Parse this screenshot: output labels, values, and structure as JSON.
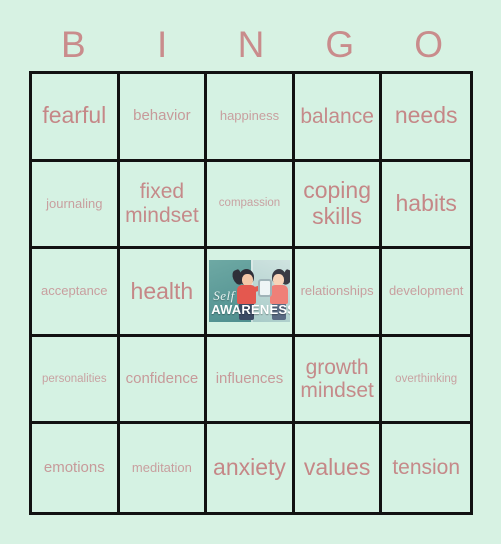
{
  "card": {
    "title": "BINGO",
    "header_letters": [
      "B",
      "I",
      "N",
      "G",
      "O"
    ],
    "background_color": "#d7f2e3",
    "cell_color": "#d5f2e3",
    "border_color": "#121212",
    "text_color": "#c89393",
    "header_color": "#c98c8c"
  },
  "free_space": {
    "row": 3,
    "column": 3,
    "image_name": "self-awareness-illustration",
    "script_text": "Self",
    "bold_text": "AWARENESS",
    "description": "girl holding a hand mirror with her reflection"
  },
  "rows": [
    [
      {
        "label": "fearful",
        "size": "xl"
      },
      {
        "label": "behavior",
        "size": "md"
      },
      {
        "label": "happiness",
        "size": "sm"
      },
      {
        "label": "balance",
        "size": "lg"
      },
      {
        "label": "needs",
        "size": "xl"
      }
    ],
    [
      {
        "label": "journaling",
        "size": "sm"
      },
      {
        "label": "fixed mindset",
        "size": "lg"
      },
      {
        "label": "compassion",
        "size": "xs"
      },
      {
        "label": "coping skills",
        "size": "xl"
      },
      {
        "label": "habits",
        "size": "xl"
      }
    ],
    [
      {
        "label": "acceptance",
        "size": "sm"
      },
      {
        "label": "health",
        "size": "xl"
      },
      {
        "label": "",
        "size": "free"
      },
      {
        "label": "relationships",
        "size": "sm"
      },
      {
        "label": "development",
        "size": "sm"
      }
    ],
    [
      {
        "label": "personalities",
        "size": "xs"
      },
      {
        "label": "confidence",
        "size": "md"
      },
      {
        "label": "influences",
        "size": "md"
      },
      {
        "label": "growth mindset",
        "size": "lg"
      },
      {
        "label": "overthinking",
        "size": "xs"
      }
    ],
    [
      {
        "label": "emotions",
        "size": "md"
      },
      {
        "label": "meditation",
        "size": "sm"
      },
      {
        "label": "anxiety",
        "size": "xl"
      },
      {
        "label": "values",
        "size": "xl"
      },
      {
        "label": "tension",
        "size": "lg"
      }
    ]
  ]
}
